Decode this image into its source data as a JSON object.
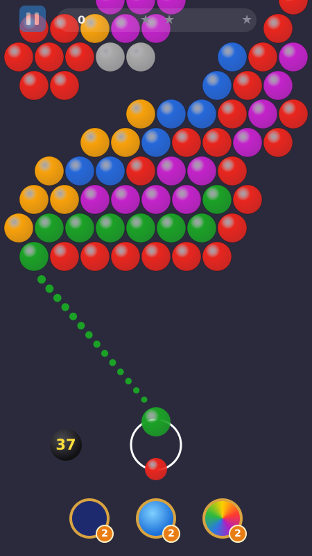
{
  "hud": {
    "score": "0",
    "star_count": 3
  },
  "board": {
    "colors": {
      "R": "#e8261e",
      "Y": "#f7a10b",
      "B": "#2668d9",
      "M": "#c323c9",
      "G": "#1ba126",
      "S": "#a8a8a8"
    },
    "rows": [
      [
        ".",
        ".",
        ".",
        "M",
        "M",
        "M",
        ".",
        ".",
        ".",
        "R"
      ],
      [
        "R",
        "R",
        "Y",
        "M",
        "M",
        ".",
        ".",
        ".",
        "R",
        "."
      ],
      [
        "R",
        "R",
        "R",
        "S",
        "S",
        ".",
        ".",
        "B",
        "R",
        "M"
      ],
      [
        "R",
        "R",
        ".",
        ".",
        ".",
        ".",
        "B",
        "R",
        "M",
        "."
      ],
      [
        ".",
        ".",
        ".",
        ".",
        "Y",
        "B",
        "B",
        "R",
        "M",
        "R"
      ],
      [
        ".",
        ".",
        "Y",
        "Y",
        "B",
        "R",
        "R",
        "M",
        "R",
        "."
      ],
      [
        ".",
        "Y",
        "B",
        "B",
        "R",
        "M",
        "M",
        "R",
        ".",
        "."
      ],
      [
        "Y",
        "Y",
        "M",
        "M",
        "M",
        "M",
        "G",
        "R",
        ".",
        "."
      ],
      [
        "Y",
        "G",
        "G",
        "G",
        "G",
        "G",
        "G",
        "R",
        ".",
        "."
      ],
      [
        "G",
        "R",
        "R",
        "R",
        "R",
        "R",
        "R",
        ".",
        ".",
        "."
      ]
    ]
  },
  "shooter": {
    "current_color": "G",
    "next_color": "R"
  },
  "shots_left": "37",
  "powerups": [
    {
      "name": "bomb",
      "count": "2"
    },
    {
      "name": "lightning",
      "count": "2"
    },
    {
      "name": "rainbow",
      "count": "2"
    }
  ]
}
